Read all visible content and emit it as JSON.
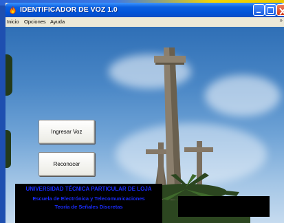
{
  "window": {
    "title": "IDENTIFICADOR DE VOZ 1.0",
    "icon": "app-flame-icon",
    "controls": {
      "minimize_icon": "minimize-icon",
      "maximize_icon": "maximize-icon",
      "close_icon": "close-icon"
    }
  },
  "menu": {
    "items": [
      "Inicio",
      "Opciones",
      "Ayuda"
    ],
    "overflow_icon": "menu-overflow-icon"
  },
  "buttons": {
    "ingresar": "Ingresar Voz",
    "reconocer": "Reconocer"
  },
  "info": {
    "line1": "UNIVERSIDAD TÉCNICA PARTICULAR DE LOJA",
    "line2": "Escuela de Electrónica y Telecomunicaciones",
    "line3": "Teoría de Señales Discretas"
  },
  "colors": {
    "titlebar": "#0053d8",
    "info_text": "#1a2cff",
    "info_bg": "#000000"
  }
}
